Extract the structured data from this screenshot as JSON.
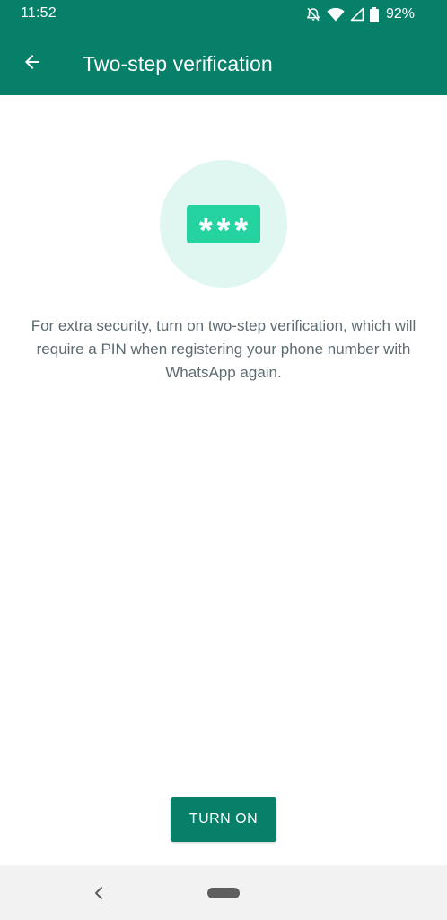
{
  "status_bar": {
    "time": "11:52",
    "battery": "92%",
    "icons": [
      "alarm-off-icon",
      "wifi-icon",
      "cellular-signal-icon",
      "battery-icon"
    ]
  },
  "app_bar": {
    "title": "Two-step verification",
    "back_icon": "arrow-back-icon"
  },
  "hero": {
    "pin_mask": "***"
  },
  "description": "For extra security, turn on two-step verification, which will require a PIN when registering your phone number with WhatsApp again.",
  "actions": {
    "turn_on_label": "TURN ON"
  },
  "nav_bar": {
    "back_icon": "nav-back-icon",
    "home_icon": "home-pill-icon"
  },
  "colors": {
    "primary": "#07806a",
    "accent": "#25d3a1",
    "hero_bg": "#dff7f0",
    "text_secondary": "#5d6b70"
  }
}
